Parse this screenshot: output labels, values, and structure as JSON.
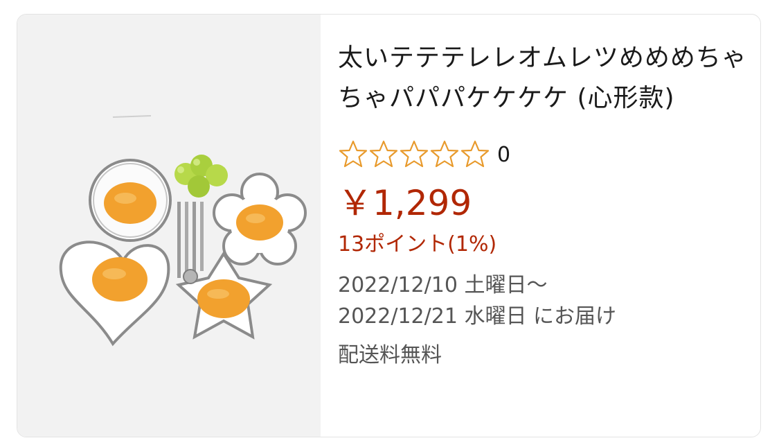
{
  "product": {
    "image_alt": "Egg ring molds: heart, flower, star shapes",
    "title": "太いテテテレレオムレツめめめちゃちゃパパパケケケケ (心形款)",
    "rating": {
      "stars_filled": 0,
      "stars_total": 5,
      "count": "0",
      "star_icon": "star-outline-icon",
      "star_color": "#e89a2c"
    },
    "price": "￥1,299",
    "price_color": "#b12704",
    "points": "13ポイント(1%)",
    "delivery_line1": "2022/12/10 土曜日～",
    "delivery_line2": "2022/12/21 水曜日 にお届け",
    "shipping": "配送料無料"
  }
}
